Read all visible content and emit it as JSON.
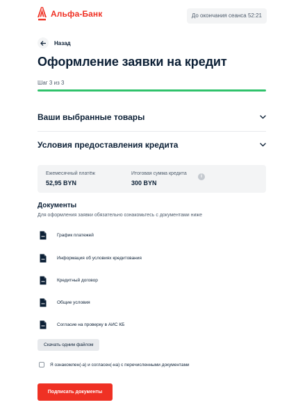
{
  "header": {
    "brand_name": "Альфа-Банк",
    "brand_color": "#ef3124",
    "logo_icon": "alfa-a-logo",
    "session_label": "До окончания сеанса",
    "session_time": "52:21",
    "session_text": "До окончания сеанса 52:21"
  },
  "nav": {
    "back_label": "Назад",
    "back_icon": "arrow-left-icon"
  },
  "page": {
    "title": "Оформление заявки на кредит",
    "step_text": "Шаг 3 из 3",
    "step_current": 3,
    "step_total": 3,
    "progress_fraction": 1.0,
    "progress_color": "#2fc26b"
  },
  "sections": [
    {
      "title": "Ваши выбранные товары",
      "icon": "chevron-down-icon"
    },
    {
      "title": "Условия предоставления кредита",
      "icon": "chevron-down-icon"
    }
  ],
  "summary": {
    "monthly_label": "Ежемесячный платёж",
    "monthly_value": "52,95 BYN",
    "total_label": "Итоговая сумма кредита",
    "total_value": "300 BYN",
    "info_icon": "info-icon"
  },
  "documents": {
    "title": "Документы",
    "subtitle": "Для оформления заявки обязательно ознакомьтесь с документами ниже",
    "items": [
      {
        "label": "График платежей",
        "icon": "document-icon"
      },
      {
        "label": "Информация об условиях кредитования",
        "icon": "document-icon"
      },
      {
        "label": "Кредитный договор",
        "icon": "document-icon"
      },
      {
        "label": "Общие условия",
        "icon": "document-icon"
      },
      {
        "label": "Согласие на проверку в АИС КБ",
        "icon": "document-icon"
      }
    ],
    "download_all_label": "Скачать одним файлом",
    "agree_label": "Я ознакомлен(-а) и согласен(-на) с перечисленными документами",
    "agree_checked": false,
    "submit_label": "Подписать документы"
  }
}
